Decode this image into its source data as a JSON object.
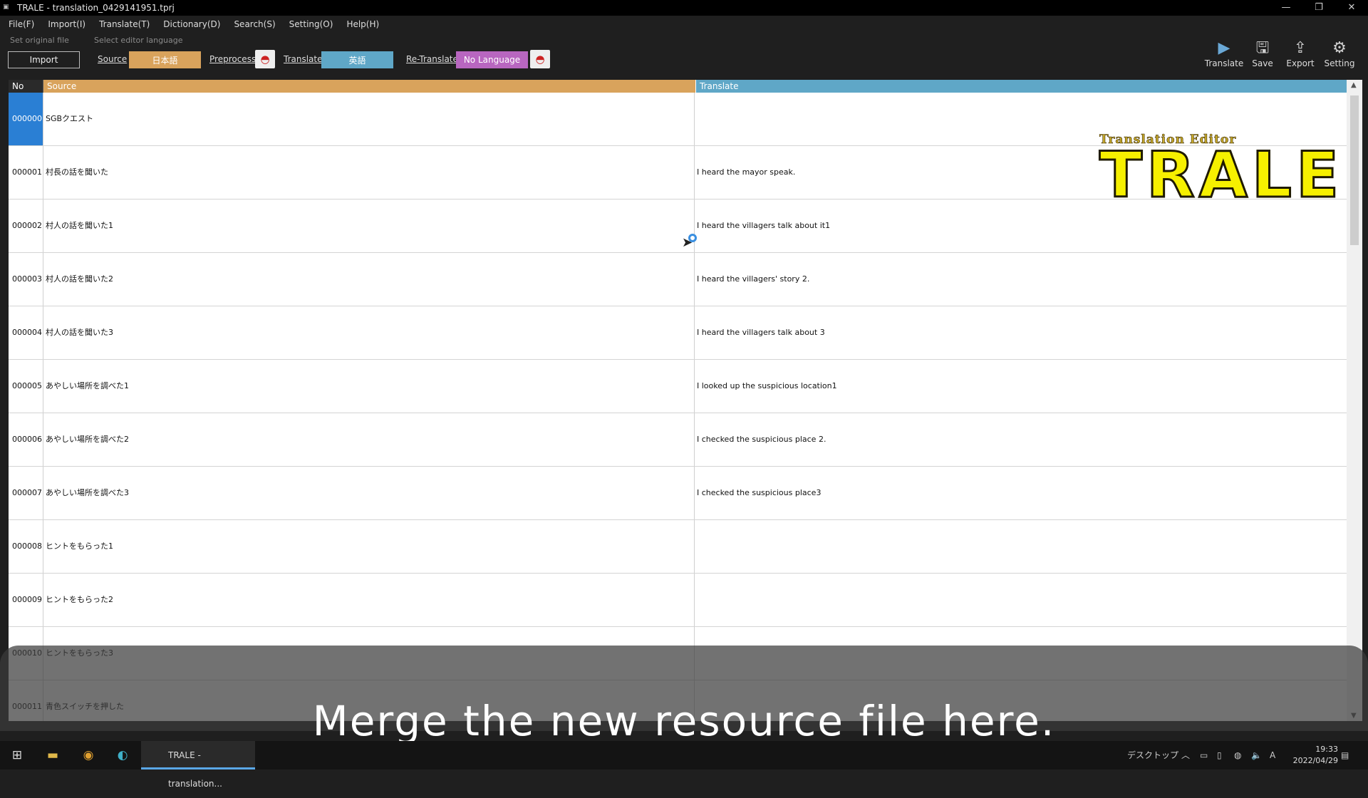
{
  "window": {
    "title": "TRALE - translation_0429141951.tprj",
    "app_icon": "trale-app-icon"
  },
  "menu": [
    "File(F)",
    "Import(I)",
    "Translate(T)",
    "Dictionary(D)",
    "Search(S)",
    "Setting(O)",
    "Help(H)"
  ],
  "toolbar": {
    "hint_original": "Set original file",
    "hint_language": "Select editor language",
    "import_label": "Import",
    "source_link": "Source",
    "source_lang": "日本語",
    "preprocess_link": "Preprocess",
    "translate_link": "Translate",
    "translate_lang": "英語",
    "retranslate_link": "Re-Translate",
    "retranslate_lang": "No Language",
    "right": [
      {
        "label": "Translate",
        "icon": "play-icon"
      },
      {
        "label": "Save",
        "icon": "save-icon"
      },
      {
        "label": "Export",
        "icon": "export-icon"
      },
      {
        "label": "Setting",
        "icon": "gear-icon"
      }
    ]
  },
  "grid": {
    "headers": {
      "no": "No",
      "source": "Source",
      "translate": "Translate"
    },
    "rows": [
      {
        "no": "000000",
        "source": "SGBクエスト",
        "translate": "",
        "selected": true
      },
      {
        "no": "000001",
        "source": "村長の話を聞いた",
        "translate": "I heard the mayor speak."
      },
      {
        "no": "000002",
        "source": "村人の話を聞いた1",
        "translate": "I heard the villagers talk about it1"
      },
      {
        "no": "000003",
        "source": "村人の話を聞いた2",
        "translate": "I heard the villagers' story 2."
      },
      {
        "no": "000004",
        "source": "村人の話を聞いた3",
        "translate": "I heard the villagers talk about 3"
      },
      {
        "no": "000005",
        "source": "あやしい場所を調べた1",
        "translate": "I looked up the suspicious location1"
      },
      {
        "no": "000006",
        "source": "あやしい場所を調べた2",
        "translate": "I checked the suspicious place 2."
      },
      {
        "no": "000007",
        "source": "あやしい場所を調べた3",
        "translate": "I checked the suspicious place3"
      },
      {
        "no": "000008",
        "source": "ヒントをもらった1",
        "translate": ""
      },
      {
        "no": "000009",
        "source": "ヒントをもらった2",
        "translate": ""
      },
      {
        "no": "000010",
        "source": "ヒントをもらった3",
        "translate": ""
      },
      {
        "no": "000011",
        "source": "青色スイッチを押した",
        "translate": ""
      }
    ]
  },
  "logo": {
    "small": "Translation Editor",
    "big": "TRALE"
  },
  "subtitle": "Merge the new resource file here.",
  "taskbar": {
    "task_label": "TRALE - translation...",
    "desktop_label": "デスクトップ",
    "ime_label": "A",
    "time": "19:33",
    "date": "2022/04/29"
  }
}
